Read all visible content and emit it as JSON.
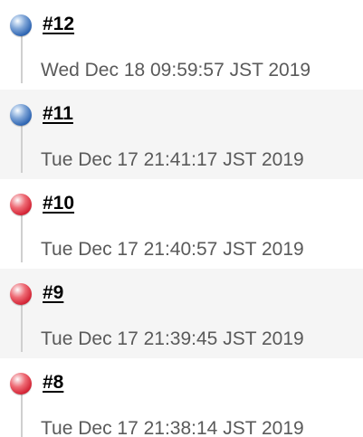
{
  "colors": {
    "success": "#2f66b3",
    "failure": "#d42637",
    "alt_row_background": "#f5f5f5"
  },
  "builds": [
    {
      "number": "#12",
      "timestamp": "Wed Dec 18 09:59:57 JST 2019",
      "status": "success",
      "icon": "blue-ball-icon"
    },
    {
      "number": "#11",
      "timestamp": "Tue Dec 17 21:41:17 JST 2019",
      "status": "success",
      "icon": "blue-ball-icon"
    },
    {
      "number": "#10",
      "timestamp": "Tue Dec 17 21:40:57 JST 2019",
      "status": "failure",
      "icon": "red-ball-icon"
    },
    {
      "number": "#9",
      "timestamp": "Tue Dec 17 21:39:45 JST 2019",
      "status": "failure",
      "icon": "red-ball-icon"
    },
    {
      "number": "#8",
      "timestamp": "Tue Dec 17 21:38:14 JST 2019",
      "status": "failure",
      "icon": "red-ball-icon"
    }
  ]
}
